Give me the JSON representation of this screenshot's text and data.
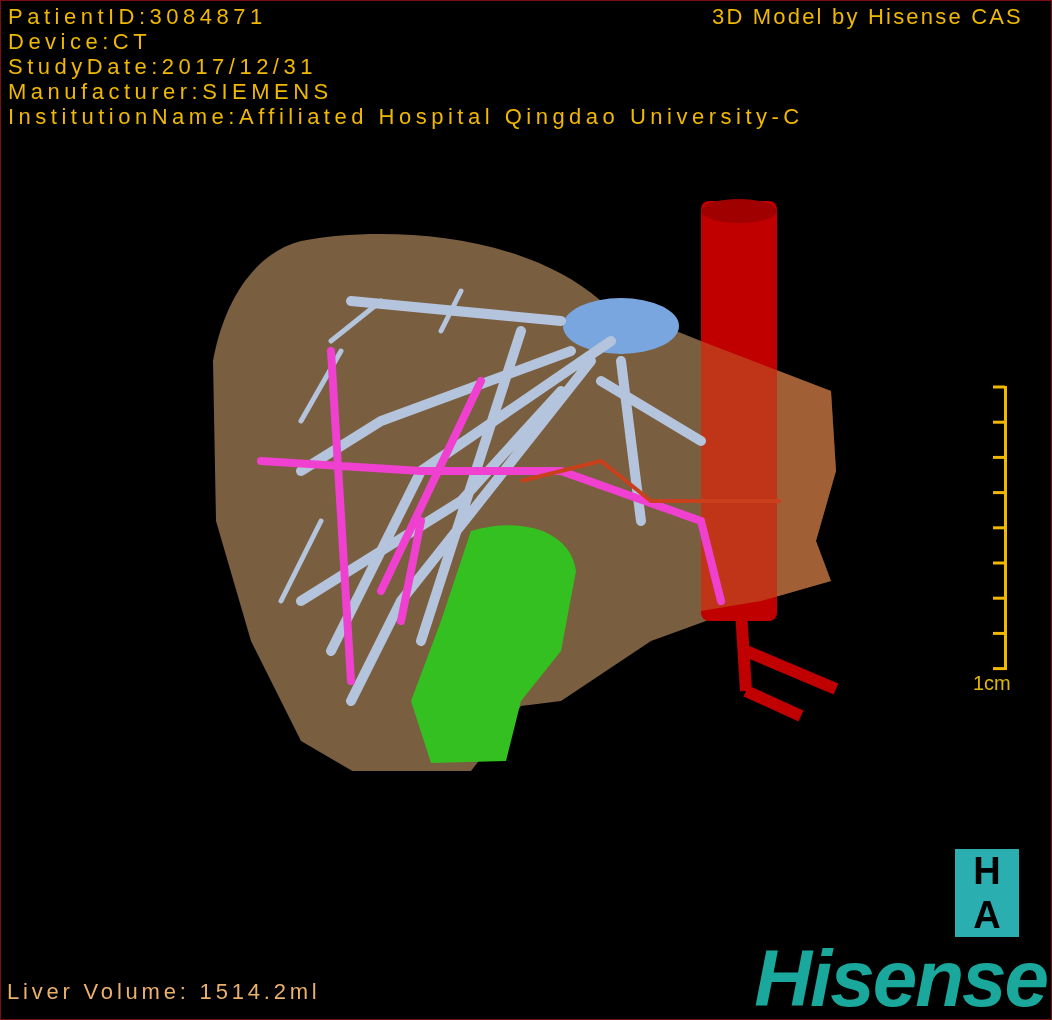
{
  "info_lines": [
    "PatientID:3084871",
    "Device:CT",
    "StudyDate:2017/12/31",
    "Manufacturer:SIEMENS",
    "InstitutionName:Affiliated Hospital Qingdao University-C"
  ],
  "title": "3D Model by Hisense CAS",
  "scale_bar": {
    "label": "1cm"
  },
  "orientation_cube": [
    "H",
    "A"
  ],
  "liver_volume": "Liver Volume: 1514.2ml",
  "logo": "Hisense"
}
